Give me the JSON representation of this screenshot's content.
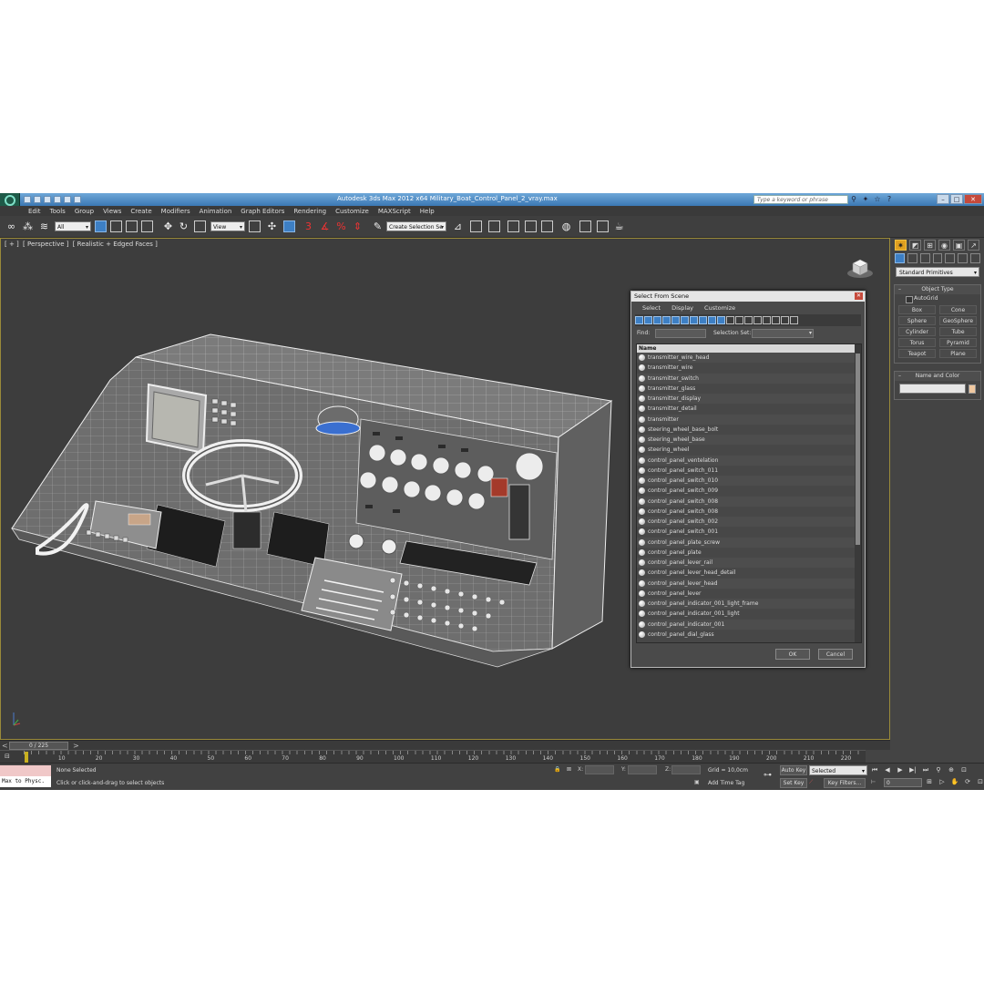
{
  "window": {
    "title": "Autodesk 3ds Max  2012 x64      Military_Boat_Control_Panel_2_vray.max",
    "search_placeholder": "Type a keyword or phrase"
  },
  "menu": [
    "Edit",
    "Tools",
    "Group",
    "Views",
    "Create",
    "Modifiers",
    "Animation",
    "Graph Editors",
    "Rendering",
    "Customize",
    "MAXScript",
    "Help"
  ],
  "toolbar": {
    "filter_value": "All",
    "coord_value": "View",
    "named_selection": "Create Selection Se"
  },
  "viewport": {
    "labels": [
      "[ + ]",
      "[ Perspective ]",
      "[ Realistic + Edged Faces ]"
    ]
  },
  "command_panel": {
    "category": "Standard Primitives",
    "object_type_title": "Object Type",
    "autogrid": "AutoGrid",
    "buttons": [
      "Box",
      "Cone",
      "Sphere",
      "GeoSphere",
      "Cylinder",
      "Tube",
      "Torus",
      "Pyramid",
      "Teapot",
      "Plane"
    ],
    "name_color_title": "Name and Color",
    "color": "#f0c8a0"
  },
  "dialog": {
    "title": "Select From Scene",
    "menu": [
      "Select",
      "Display",
      "Customize"
    ],
    "find_label": "Find:",
    "selection_set_label": "Selection Set:",
    "column_header": "Name",
    "items": [
      "transmitter_wire_head",
      "transmitter_wire",
      "transmitter_switch",
      "transmitter_glass",
      "transmitter_display",
      "transmitter_detail",
      "transmitter",
      "steering_wheel_base_bolt",
      "steering_wheel_base",
      "steering_wheel",
      "control_panel_ventelation",
      "control_panel_switch_011",
      "control_panel_switch_010",
      "control_panel_switch_009",
      "control_panel_switch_008",
      "control_panel_switch_008",
      "control_panel_switch_002",
      "control_panel_switch_001",
      "control_panel_plate_screw",
      "control_panel_plate",
      "control_panel_lever_rail",
      "control_panel_lever_head_detail",
      "control_panel_lever_head",
      "control_panel_lever",
      "control_panel_indicator_001_light_frame",
      "control_panel_indicator_001_light",
      "control_panel_indicator_001",
      "control_panel_dial_glass"
    ],
    "ok": "OK",
    "cancel": "Cancel"
  },
  "timeline": {
    "frame_counter": "0 / 225",
    "ticks": [
      "0",
      "10",
      "20",
      "30",
      "40",
      "50",
      "60",
      "70",
      "80",
      "90",
      "100",
      "110",
      "120",
      "130",
      "140",
      "150",
      "160",
      "170",
      "180",
      "190",
      "200",
      "210",
      "220"
    ]
  },
  "status": {
    "maxscript_label": "Max to Physc.",
    "selection": "None Selected",
    "prompt": "Click or click-and-drag to select objects",
    "x_label": "X:",
    "y_label": "Y:",
    "z_label": "Z:",
    "grid": "Grid = 10,0cm",
    "add_time_tag": "Add Time Tag",
    "auto_key": "Auto Key",
    "set_key": "Set Key",
    "selected_value": "Selected",
    "key_filters": "Key Filters...",
    "current_frame": "0"
  }
}
